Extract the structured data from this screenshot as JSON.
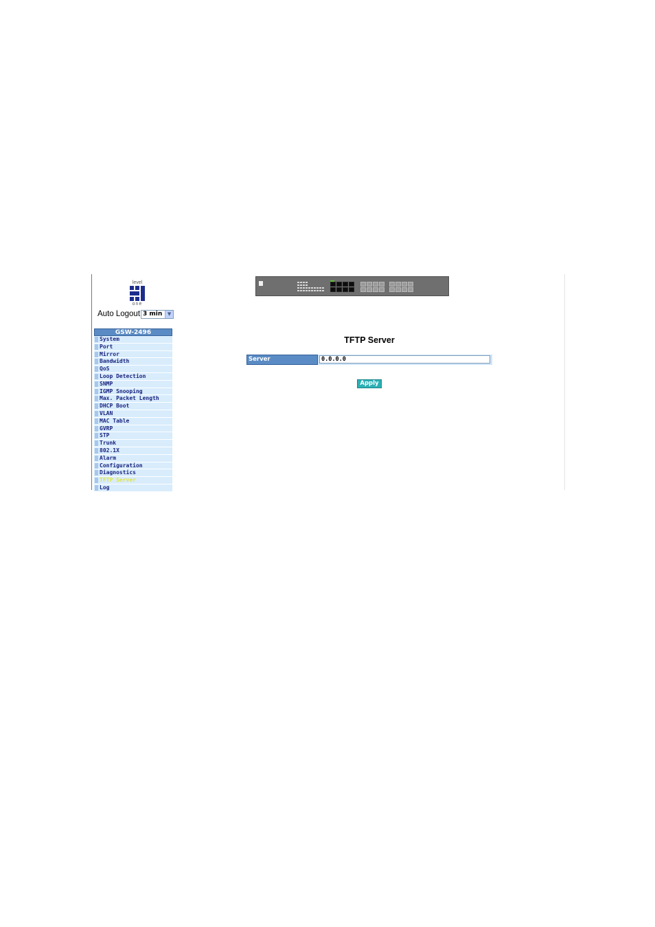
{
  "logo": {
    "top_text": "level",
    "bottom_text": "one"
  },
  "auto_logout": {
    "label": "Auto Logout",
    "selected": "3 min"
  },
  "menu": {
    "header": "GSW-2496",
    "active": "TFTP Server",
    "items": [
      "System",
      "Port",
      "Mirror",
      "Bandwidth",
      "QoS",
      "Loop Detection",
      "SNMP",
      "IGMP Snooping",
      "Max. Packet Length",
      "DHCP Boot",
      "VLAN",
      "MAC Table",
      "GVRP",
      "STP",
      "Trunk",
      "802.1X",
      "Alarm",
      "Configuration",
      "Diagnostics",
      "TFTP Server",
      "Log"
    ]
  },
  "device_image": {
    "icon": "switch-front-panel-image"
  },
  "main": {
    "title": "TFTP Server",
    "server": {
      "label": "Server",
      "value": "0.0.0.0"
    },
    "apply_label": "Apply"
  },
  "colors": {
    "menu_header": "#5a8bc4",
    "menu_item_bg": "#d8ecfc",
    "menu_text": "#1a237e",
    "menu_active_text": "#e1e640",
    "apply_button": "#2ab0b5"
  }
}
